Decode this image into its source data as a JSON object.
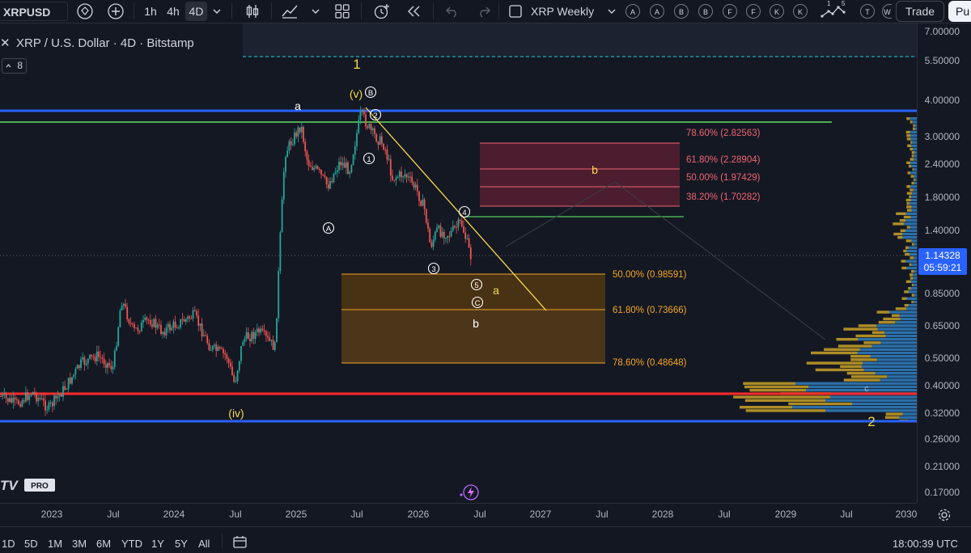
{
  "toolbar": {
    "symbol": "XRPUSD",
    "intervals": [
      "1h",
      "4h",
      "4D"
    ],
    "active_interval": "4D",
    "layout_name": "XRP Weekly",
    "alert_buttons": [
      "A",
      "A",
      "B",
      "B",
      "F",
      "F",
      "K",
      "K"
    ],
    "wave_tool_labels": [
      "1",
      "5"
    ],
    "extra_buttons": [
      "T",
      "W"
    ],
    "trade_label": "Trade",
    "publish_label": "Pu"
  },
  "legend": {
    "close_glyph": "✕",
    "title": "XRP / U.S. Dollar · 4D · Bitstamp",
    "indicator_count": "8"
  },
  "price_scale": {
    "ticks": [
      "7.00000",
      "5.50000",
      "4.00000",
      "3.00000",
      "2.40000",
      "1.80000",
      "1.40000",
      "0.85000",
      "0.65000",
      "0.50000",
      "0.40000",
      "0.32000",
      "0.26000",
      "0.21000",
      "0.17000"
    ],
    "last_price": "1.14328",
    "countdown": "05:59:21"
  },
  "time_axis": {
    "ticks": [
      "2023",
      "Jul",
      "2024",
      "Jul",
      "2025",
      "Jul",
      "2026",
      "Jul",
      "2027",
      "Jul",
      "2028",
      "Jul",
      "2029",
      "Jul",
      "2030"
    ]
  },
  "bottom_bar": {
    "ranges": [
      "1D",
      "5D",
      "1M",
      "3M",
      "6M",
      "YTD",
      "1Y",
      "5Y",
      "All"
    ],
    "clock": "18:00:39 UTC"
  },
  "annotations": {
    "wave_labels": [
      "1",
      "a",
      "(v)",
      "B",
      "2",
      "1",
      "A",
      "3",
      "4",
      "5",
      "a",
      "C",
      "b",
      "b",
      "(iv)",
      "2",
      "c"
    ],
    "upper_zone": [
      {
        "pct": "78.60%",
        "price": "2.82563"
      },
      {
        "pct": "61.80%",
        "price": "2.28904"
      },
      {
        "pct": "50.00%",
        "price": "1.97429"
      },
      {
        "pct": "38.20%",
        "price": "1.70282"
      }
    ],
    "lower_zone": [
      {
        "pct": "50.00%",
        "price": "0.98591"
      },
      {
        "pct": "61.80%",
        "price": "0.73666"
      },
      {
        "pct": "78.60%",
        "price": "0.48648"
      }
    ]
  },
  "branding": {
    "logo_text": "TV",
    "pro_badge": "PRO"
  },
  "colors": {
    "background": "#141823",
    "up_candle": "#26a69a",
    "down_candle": "#ef5350",
    "wave_yellow": "#f7d84a",
    "fib_orange": "#f5a623",
    "fib_red": "#f06472",
    "support_red": "#ff2a2a",
    "support_blue": "#2962ff",
    "resistance_green": "#4caf50",
    "last_price_blue": "#2962ff"
  }
}
